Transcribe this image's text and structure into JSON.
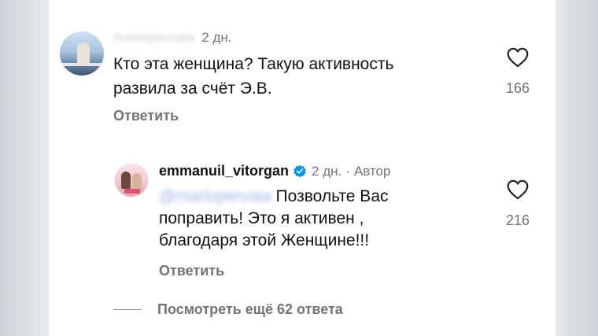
{
  "comment1": {
    "username_blurred": "marlopervaia",
    "time": "2 дн.",
    "text": "Кто эта женщина? Такую активность развила за счёт Э.В.",
    "likes": "166",
    "reply_label": "Ответить"
  },
  "comment2": {
    "username": "emmanuil_vitorgan",
    "time": "2 дн.",
    "separator": "·",
    "author_badge": "Автор",
    "mention_blurred": "@marlopervaia",
    "text": " Позвольте Вас\nпоправить! Это я активен ,\nблагодаря  этой Женщине!!!",
    "likes": "216",
    "reply_label": "Ответить"
  },
  "view_more": {
    "label": "Посмотреть ещё 62 ответа"
  },
  "colors": {
    "verified": "#0095f6",
    "secondary_text": "#737373",
    "primary_text": "#111111"
  }
}
